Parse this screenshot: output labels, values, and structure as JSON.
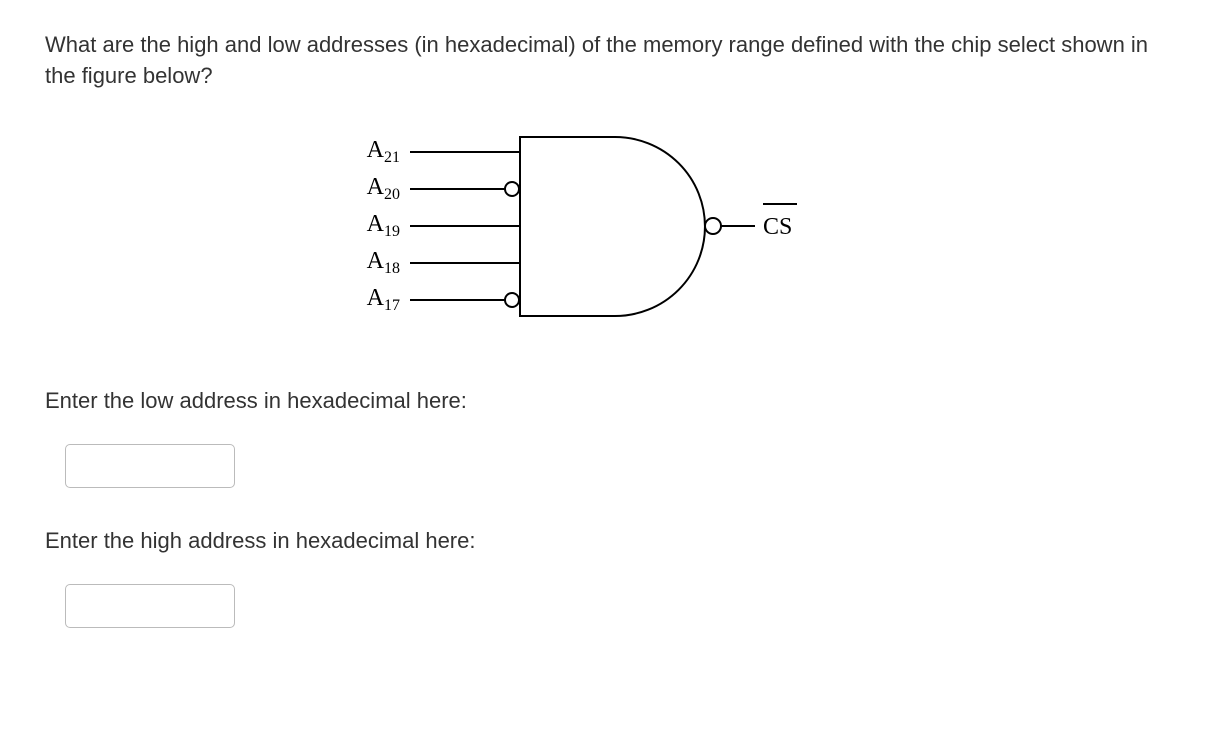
{
  "question": "What are the high and low addresses (in hexadecimal) of the memory range defined with the chip select shown in the figure below?",
  "diagram": {
    "inputs": [
      {
        "base": "A",
        "sub": "21",
        "inverted": false
      },
      {
        "base": "A",
        "sub": "20",
        "inverted": true
      },
      {
        "base": "A",
        "sub": "19",
        "inverted": false
      },
      {
        "base": "A",
        "sub": "18",
        "inverted": false
      },
      {
        "base": "A",
        "sub": "17",
        "inverted": true
      }
    ],
    "output": {
      "label": "CS",
      "overline": true,
      "inverted": true
    }
  },
  "prompt_low": "Enter the low address in hexadecimal here:",
  "prompt_high": "Enter the high address in hexadecimal here:",
  "inputs": {
    "low": "",
    "high": ""
  }
}
